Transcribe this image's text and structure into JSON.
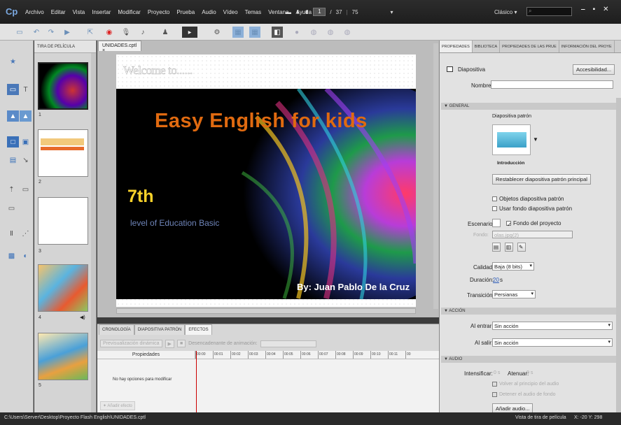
{
  "app": {
    "logo": "Cp"
  },
  "menu": [
    "Archivo",
    "Editar",
    "Vista",
    "Insertar",
    "Modificar",
    "Proyecto",
    "Prueba",
    "Audio",
    "Vídeo",
    "Temas",
    "Ventana",
    "Ayuda"
  ],
  "nav": {
    "current_page": "1",
    "sep": "/",
    "total_pages": "37",
    "zoom": "75"
  },
  "workspace": {
    "label": "Clásico ▾"
  },
  "filmstrip": {
    "title": "TIRA DE PELÍCULA",
    "slides": [
      {
        "num": "1"
      },
      {
        "num": "2"
      },
      {
        "num": "3"
      },
      {
        "num": "4"
      },
      {
        "num": "5"
      }
    ]
  },
  "document": {
    "tab_label": "UNIDADES.cptl ×"
  },
  "slide": {
    "welcome": "Welcome to......",
    "title": "Easy English for kids",
    "grade": "7th",
    "level": "level of Education Basic",
    "author": "By: Juan Pablo De la Cruz"
  },
  "timeline": {
    "tabs": [
      "CRONOLOGÍA",
      "DIAPOSITIVA PATRÓN",
      "EFECTOS"
    ],
    "preview_btn": "Previsualización dinámica",
    "trigger_label": "Desencadenante de animación:",
    "props_header": "Propiedades",
    "ruler": [
      "00:00",
      "00:01",
      "00:02",
      "00:03",
      "00:04",
      "00:05",
      "00:06",
      "00:07",
      "00:08",
      "00:09",
      "00:10",
      "00:11",
      "00"
    ],
    "no_options": "No hay opciones para modificar",
    "add_effect": "Añadir efecto"
  },
  "props": {
    "tabs": [
      "PROPIEDADES",
      "BIBLIOTECA",
      "PROPIEDADES DE LAS PRUE",
      "INFORMACIÓN DEL PROYE"
    ],
    "object_type": "Diapositiva",
    "accessibility_btn": "Accesibilidad...",
    "name_label": "Nombre:",
    "section_general": "GENERAL",
    "master_label": "Diapositiva patrón",
    "master_name": "Introducción",
    "reset_btn": "Restablecer diapositiva patrón principal",
    "chk_master_objects": "Objetos diapositiva patrón",
    "chk_master_bg": "Usar fondo diapositiva patrón",
    "stage_label": "Escenario:",
    "chk_project_bg": "Fondo del proyecto",
    "bg_label": "Fondo:",
    "bg_value": "olas.jpg(2)",
    "quality_label": "Calidad:",
    "quality_value": "Baja (8 bits)",
    "duration_label": "Duración:",
    "duration_value": "20",
    "duration_unit": "s",
    "transition_label": "Transición:",
    "transition_value": "Persianas",
    "section_action": "ACCIÓN",
    "on_enter_label": "Al entrar:",
    "on_enter_value": "Sin acción",
    "on_exit_label": "Al salir:",
    "on_exit_value": "Sin acción",
    "section_audio": "AUDIO",
    "fade_in_label": "Intensificar:",
    "fade_in_value": "0 s",
    "fade_out_label": "Atenuar:",
    "fade_out_value": "0 s",
    "chk_loop": "Volver al principio del audio",
    "chk_stop_bg": "Detener el audio de fondo",
    "add_audio_btn": "Añadir audio..."
  },
  "status": {
    "path": "C:\\Users\\Server\\Desktop\\Proyecto Flash English\\UNIDADES.cptl",
    "view": "Vista de tira de película",
    "coords": "X: -20 Y: 298"
  }
}
